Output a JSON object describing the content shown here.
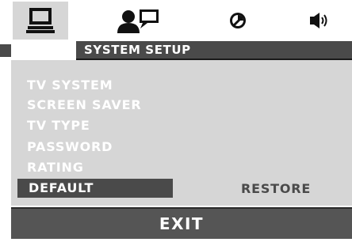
{
  "tabs": [
    {
      "icon": "monitor-icon",
      "active": true
    },
    {
      "icon": "user-speech-icon",
      "active": false
    },
    {
      "icon": "circle-slash-icon",
      "active": false
    },
    {
      "icon": "speaker-icon",
      "active": false
    }
  ],
  "header": {
    "title": "SYSTEM SETUP"
  },
  "menu": {
    "items": [
      {
        "label": "TV SYSTEM"
      },
      {
        "label": "SCREEN SAVER"
      },
      {
        "label": "TV TYPE"
      },
      {
        "label": "PASSWORD"
      },
      {
        "label": "RATING"
      },
      {
        "label": "DEFAULT",
        "selected": true
      }
    ]
  },
  "default_option": {
    "label": "RESTORE"
  },
  "footer": {
    "exit_label": "EXIT"
  },
  "colors": {
    "bar_dark": "#4a4a4a",
    "panel_light": "#d6d6d6",
    "text_light": "#ffffff"
  }
}
